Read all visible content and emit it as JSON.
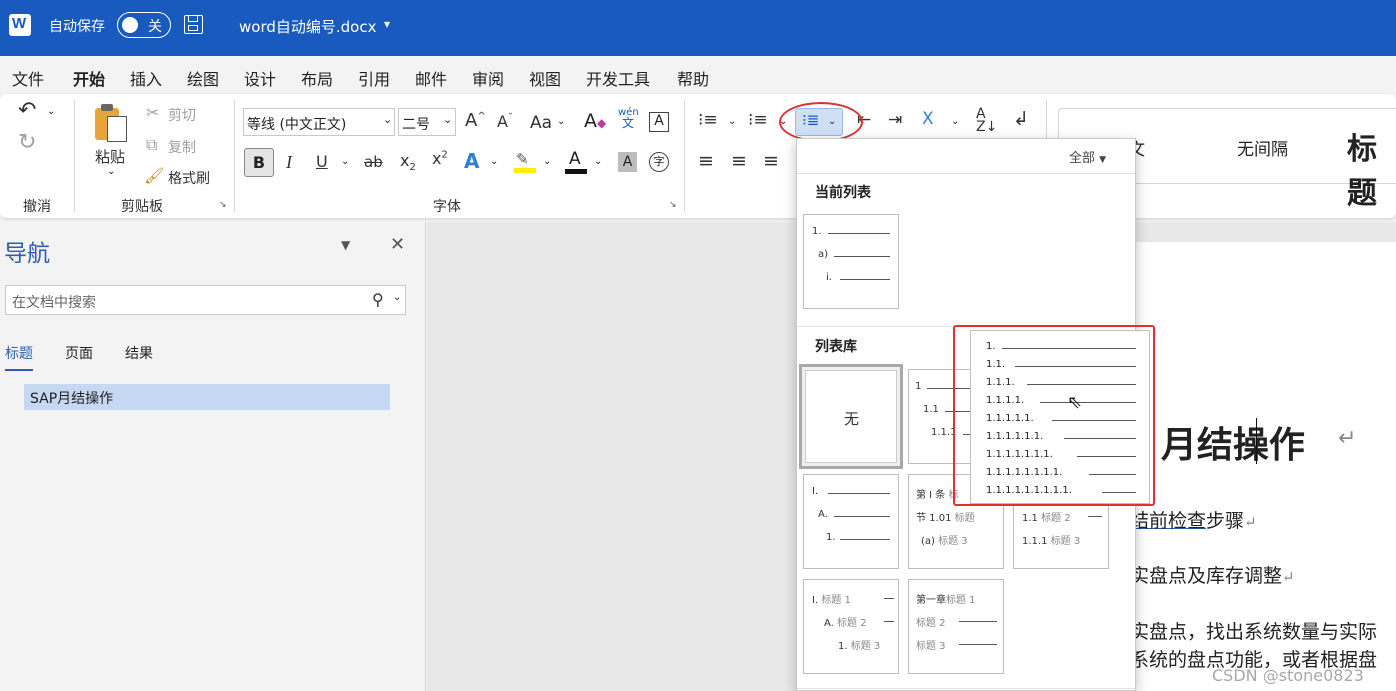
{
  "titlebar": {
    "autosave_label": "自动保存",
    "toggle_label": "关",
    "filename": "word自动编号.docx",
    "dropdown_glyph": "▾"
  },
  "menu": [
    "文件",
    "开始",
    "插入",
    "绘图",
    "设计",
    "布局",
    "引用",
    "邮件",
    "审阅",
    "视图",
    "开发工具",
    "帮助"
  ],
  "ribbon": {
    "groups": {
      "undo": "撤消",
      "clipboard": "剪贴板",
      "font": "字体"
    },
    "clipboard": {
      "paste": "粘贴",
      "cut": "剪切",
      "copy": "复制",
      "format_painter": "格式刷"
    },
    "font": {
      "name": "等线 (中文正文)",
      "size": "二号",
      "case": "Aa",
      "phonetic_top": "wén",
      "phonetic_bottom": "文"
    },
    "styles": {
      "normal": "正文",
      "no_spacing": "无间隔",
      "heading": "标题"
    }
  },
  "dropdown": {
    "filter": "全部",
    "current_list_header": "当前列表",
    "library_header": "列表库",
    "none_label": "无",
    "current_list": [
      "1.",
      "a)",
      "i."
    ],
    "library_item1": [
      "1",
      "1.1",
      "1.1.1"
    ],
    "library_item3": [
      "I.",
      "A.",
      "1."
    ],
    "library_item4": [
      {
        "prefix": "第 Ⅰ 条",
        "tag": "标"
      },
      {
        "prefix": "节 1.01",
        "tag": "标题"
      },
      {
        "prefix": "(a)",
        "tag": "标题 3"
      }
    ],
    "library_item5": [
      {
        "prefix": "1.1",
        "tag": "标题 2"
      },
      {
        "prefix": "1.1.1",
        "tag": "标题 3"
      }
    ],
    "library_item6": [
      {
        "prefix": "I.",
        "tag": "标题 1"
      },
      {
        "prefix": "A.",
        "tag": "标题 2"
      },
      {
        "prefix": "1.",
        "tag": "标题 3"
      }
    ],
    "library_item7": [
      {
        "prefix": "第一章",
        "tag": "标题 1"
      },
      {
        "prefix": "",
        "tag": "标题 2"
      },
      {
        "prefix": "",
        "tag": "标题 3"
      }
    ],
    "highlighted_levels": [
      "1.",
      "1.1.",
      "1.1.1.",
      "1.1.1.1.",
      "1.1.1.1.1.",
      "1.1.1.1.1.1.",
      "1.1.1.1.1.1.1.",
      "1.1.1.1.1.1.1.1.",
      "1.1.1.1.1.1.1.1.1."
    ]
  },
  "nav": {
    "title": "导航",
    "search_placeholder": "在文档中搜索",
    "tabs": [
      "标题",
      "页面",
      "结果"
    ],
    "headings": [
      "SAP月结操作"
    ]
  },
  "document": {
    "title": "P 月结操作",
    "line1_link": "结前检查",
    "line1_rest": "步骤",
    "line2": "实盘点及库存调整",
    "line3": "实盘点，找出系统数量与实际",
    "line4": "系统的盘点功能，或者根据盘",
    "para_mark": "↵"
  },
  "watermark": "CSDN @stone0823",
  "colors": {
    "titlebar": "#185abd",
    "highlight": "#e03030",
    "nav_selected": "#c7d9f2"
  }
}
